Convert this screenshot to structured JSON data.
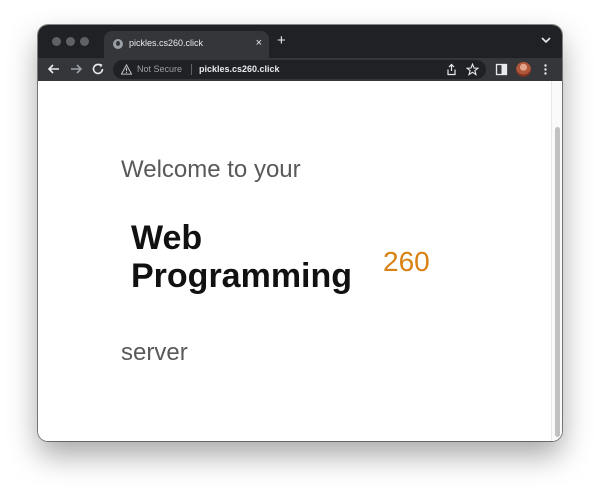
{
  "browser": {
    "tab": {
      "title": "pickles.cs260.click",
      "close_glyph": "×"
    },
    "new_tab_glyph": "+",
    "address_bar": {
      "security_label": "Not Secure",
      "url": "pickles.cs260.click"
    },
    "icons": [
      "globe-icon",
      "close-icon",
      "plus-icon",
      "chevron-down-icon",
      "back-arrow-icon",
      "forward-arrow-icon",
      "reload-icon",
      "warning-icon",
      "share-icon",
      "star-icon",
      "side-panel-icon",
      "avatar",
      "more-vert-icon"
    ],
    "colors": {
      "chrome_dark": "#202124",
      "chrome_toolbar": "#35363a",
      "accent_orange": "#d98213"
    }
  },
  "page": {
    "welcome": "Welcome to your",
    "heading_line1": "Web",
    "heading_line2": "Programming",
    "course_number": "260",
    "server": "server"
  }
}
